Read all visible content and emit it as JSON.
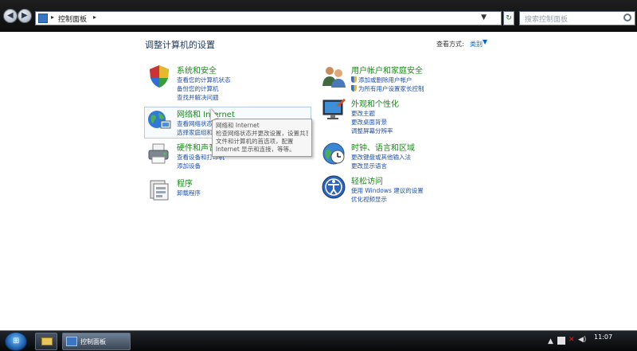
{
  "address": {
    "location": "控制面板",
    "search_placeholder": "搜索控制面板"
  },
  "header": {
    "title": "调整计算机的设置",
    "view_label": "查看方式:",
    "view_value": "类别"
  },
  "categories": [
    {
      "title": "系统和安全",
      "links": [
        "查看您的计算机状态",
        "备份您的计算机",
        "查找并解决问题"
      ]
    },
    {
      "title": "网络和 Internet",
      "links": [
        "查看网络状态和任务",
        "选择家庭组和共享选项"
      ]
    },
    {
      "title": "硬件和声音",
      "links": [
        "查看设备和打印机",
        "添加设备"
      ]
    },
    {
      "title": "程序",
      "links": [
        "卸载程序"
      ]
    },
    {
      "title": "用户帐户和家庭安全",
      "links": [
        "添加或删除用户帐户",
        "为所有用户设置家长控制"
      ]
    },
    {
      "title": "外观和个性化",
      "links": [
        "更改主题",
        "更改桌面背景",
        "调整屏幕分辨率"
      ]
    },
    {
      "title": "时钟、语言和区域",
      "links": [
        "更改键盘或其他输入法",
        "更改显示语言"
      ]
    },
    {
      "title": "轻松访问",
      "links": [
        "使用 Windows 建议的设置",
        "优化视频显示"
      ]
    }
  ],
  "tooltip": {
    "lines": [
      "网络和 Internet",
      "检查网络状态并更改设置，设置共享",
      "文件和计算机的首选项，配置",
      "Internet 显示和连接，等等。"
    ]
  },
  "taskbar": {
    "active_window": "控制面板",
    "clock": "11:07"
  }
}
